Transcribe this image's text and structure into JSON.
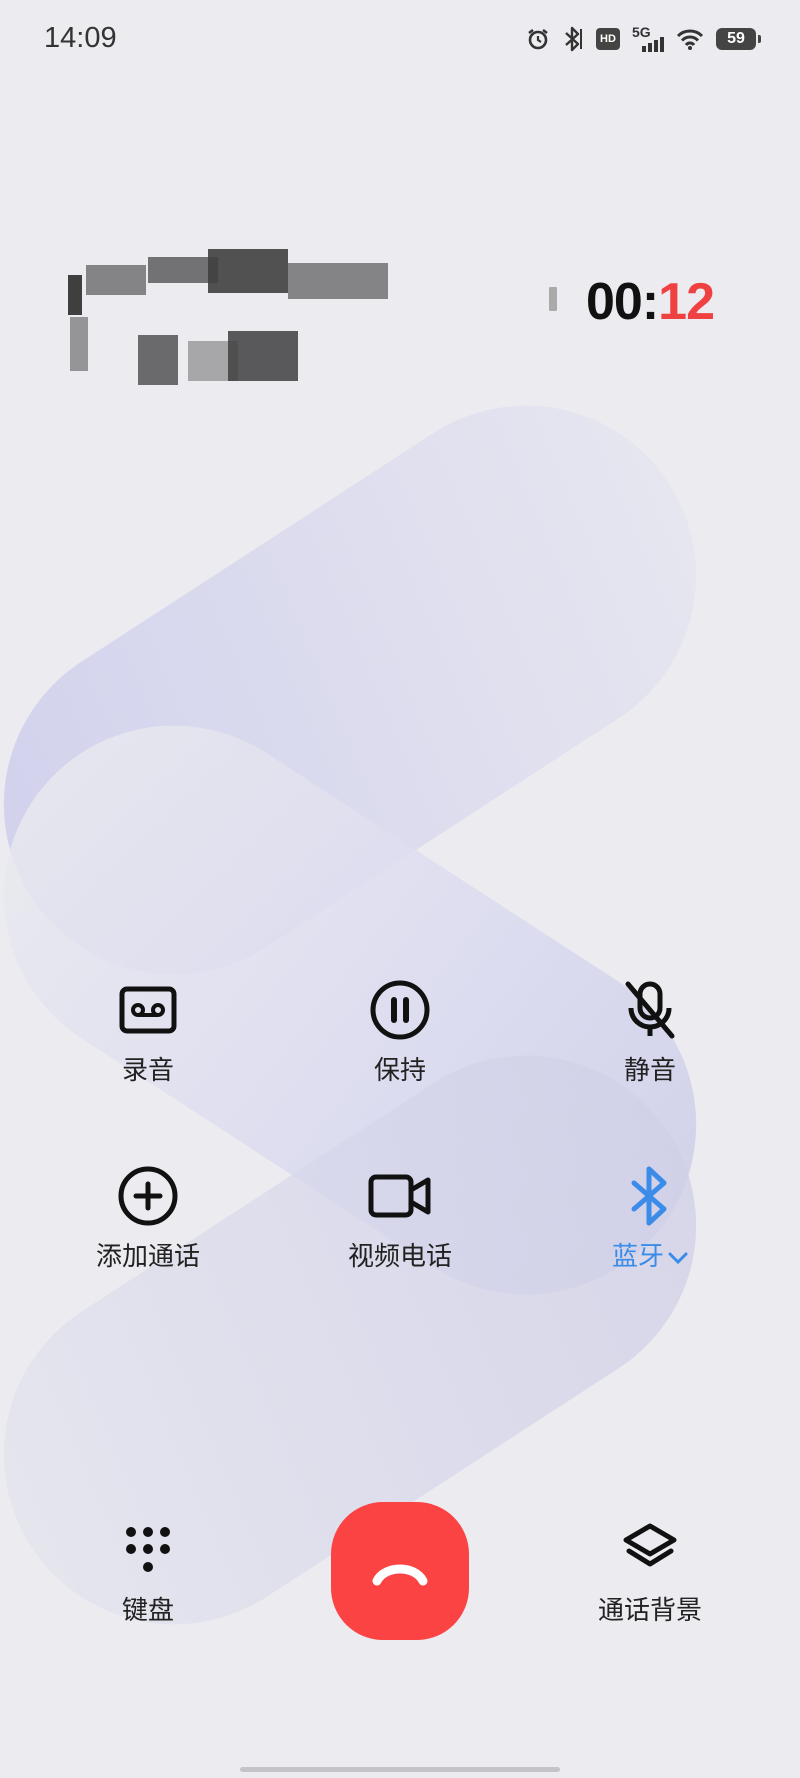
{
  "status_bar": {
    "time": "14:09",
    "network": "5G",
    "hd": "HD",
    "battery": "59",
    "icons": [
      "alarm-icon",
      "bluetooth-icon",
      "hd-icon",
      "5g-signal-icon",
      "wifi-icon",
      "battery-icon"
    ]
  },
  "call": {
    "timer_minutes": "00:",
    "timer_seconds": "12"
  },
  "controls": {
    "record": {
      "label": "录音",
      "icon": "record-icon"
    },
    "hold": {
      "label": "保持",
      "icon": "pause-icon"
    },
    "mute": {
      "label": "静音",
      "icon": "mic-off-icon"
    },
    "add_call": {
      "label": "添加通话",
      "icon": "add-circle-icon"
    },
    "video_call": {
      "label": "视频电话",
      "icon": "video-camera-icon"
    },
    "bluetooth": {
      "label": "蓝牙",
      "icon": "bluetooth-icon"
    },
    "keypad": {
      "label": "键盘",
      "icon": "keypad-icon"
    },
    "call_background": {
      "label": "通话背景",
      "icon": "layers-icon"
    },
    "end_call": {
      "icon": "hang-up-icon"
    }
  },
  "colors": {
    "accent_red": "#fb4343",
    "timer_seconds": "#ef4141",
    "bluetooth_blue": "#3b8be8",
    "background": "#ebebf0"
  }
}
